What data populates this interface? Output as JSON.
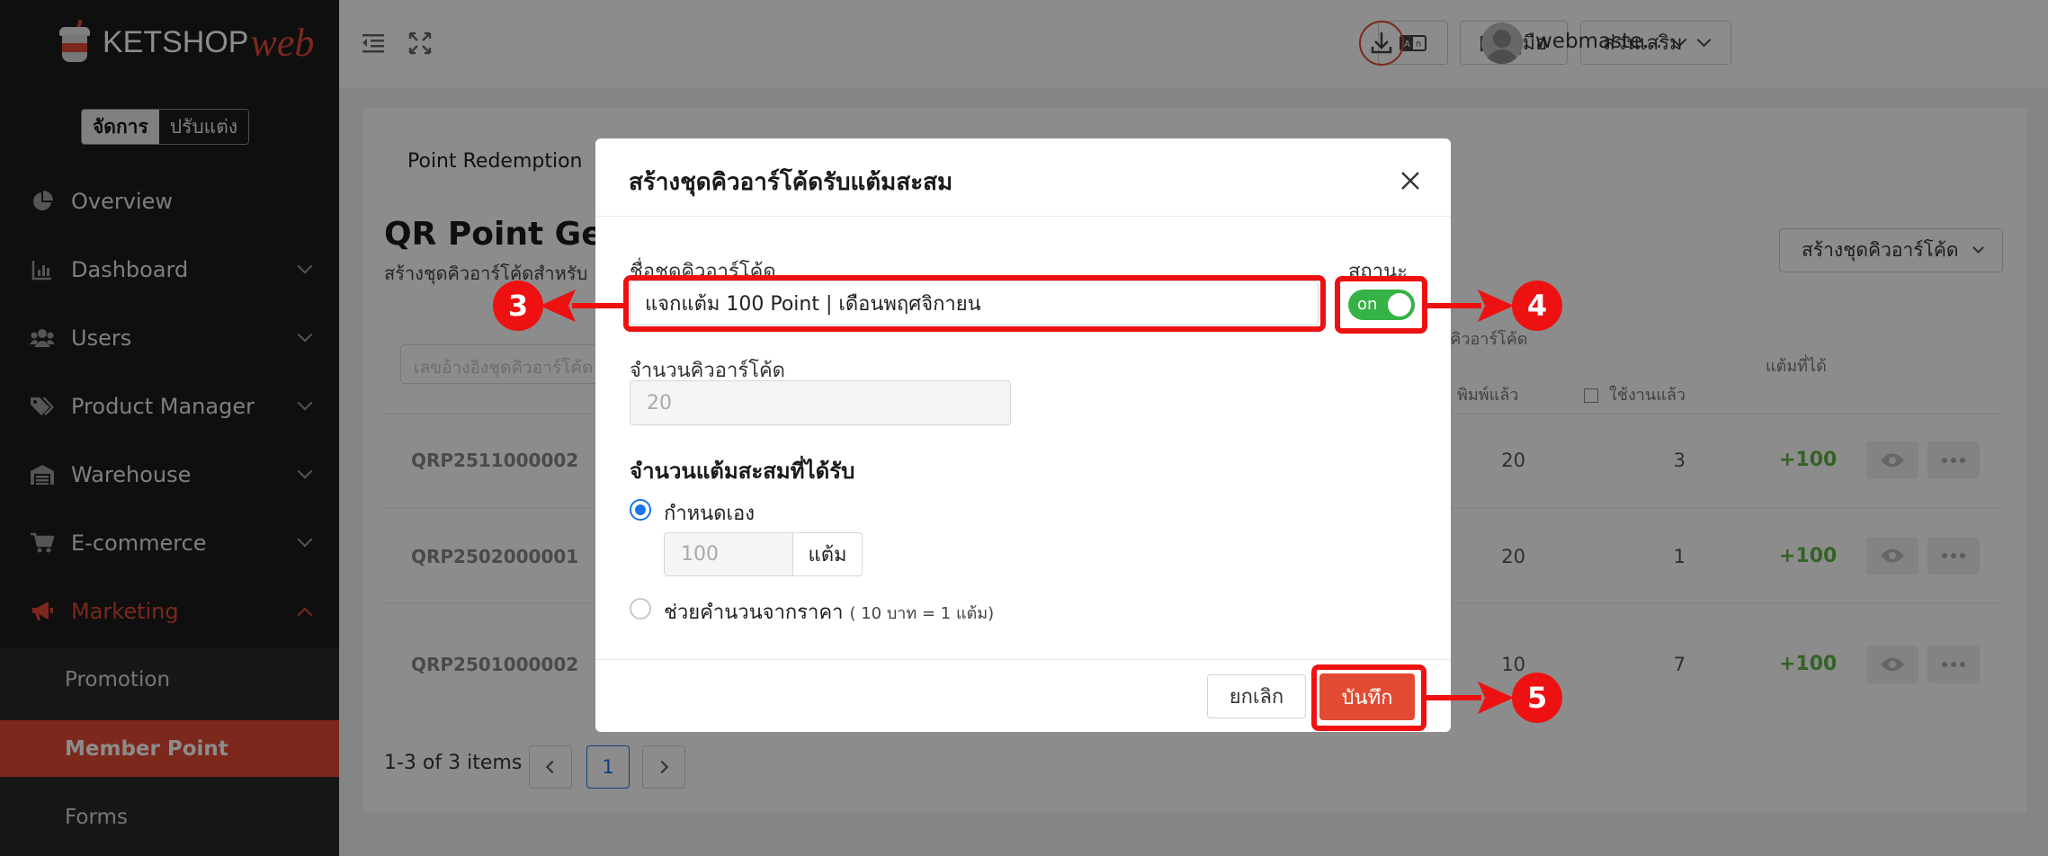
{
  "app": {
    "logo_text": "KETSHOP",
    "logo_accent": "web",
    "brand_color": "#e24a33"
  },
  "mode_switch": {
    "manage": "จัดการ",
    "customize": "ปรับแต่ง"
  },
  "sidebar": {
    "items": [
      {
        "label": "Overview"
      },
      {
        "label": "Dashboard"
      },
      {
        "label": "Users"
      },
      {
        "label": "Product Manager"
      },
      {
        "label": "Warehouse"
      },
      {
        "label": "E-commerce"
      },
      {
        "label": "Marketing"
      }
    ],
    "sub_items": [
      {
        "label": "Promotion"
      },
      {
        "label": "Member Point"
      },
      {
        "label": "Forms"
      }
    ]
  },
  "topbar": {
    "manual_label": "คู่มือ",
    "addons_label": "ส่วนเสริม",
    "user_name": "webmaste..."
  },
  "page": {
    "tab_label": "Point Redemption",
    "title": "QR Point Gene",
    "subtitle": "สร้างชุดคิวอาร์โค้ดสำหรับ",
    "create_button": "สร้างชุดคิวอาร์โค้ด",
    "search_placeholder": "เลขอ้างอิงชุดคิวอาร์โค้ด",
    "table": {
      "group_header": "นคิวอาร์โค้ด",
      "col_printed": "พิมพ์แล้ว",
      "col_used": "ใช้งานแล้ว",
      "col_points": "แต้มที่ได้",
      "rows": [
        {
          "code": "QRP2511000002",
          "printed": "20",
          "used": "3",
          "points": "+100"
        },
        {
          "code": "QRP2502000001",
          "printed": "20",
          "used": "1",
          "points": "+100"
        },
        {
          "code": "QRP2501000002",
          "printed": "10",
          "used": "7",
          "points": "+100"
        }
      ]
    },
    "pager": {
      "summary": "1-3 of 3 items",
      "current": "1"
    }
  },
  "modal": {
    "title": "สร้างชุดคิวอาร์โค้ดรับแต้มสะสม",
    "name_label": "ชื่อชุดคิวอาร์โค้ด",
    "name_value": "แจกแต้ม 100 Point | เดือนพฤศจิกายน",
    "status_label": "สถานะ",
    "toggle_label": "on",
    "qty_label": "จำนวนคิวอาร์โค้ด",
    "qty_placeholder": "20",
    "points_section": "จำนวนแต้มสะสมที่ได้รับ",
    "option_custom": "กำหนดเอง",
    "points_placeholder": "100",
    "points_unit": "แต้ม",
    "option_calc": "ช่วยคำนวนจากราคา",
    "option_calc_hint": "( 10 บาท = 1 แต้ม)",
    "cancel_label": "ยกเลิก",
    "save_label": "บันทึก"
  },
  "annotations": {
    "step3": "3",
    "step4": "4",
    "step5": "5",
    "color": "#ee1111"
  }
}
